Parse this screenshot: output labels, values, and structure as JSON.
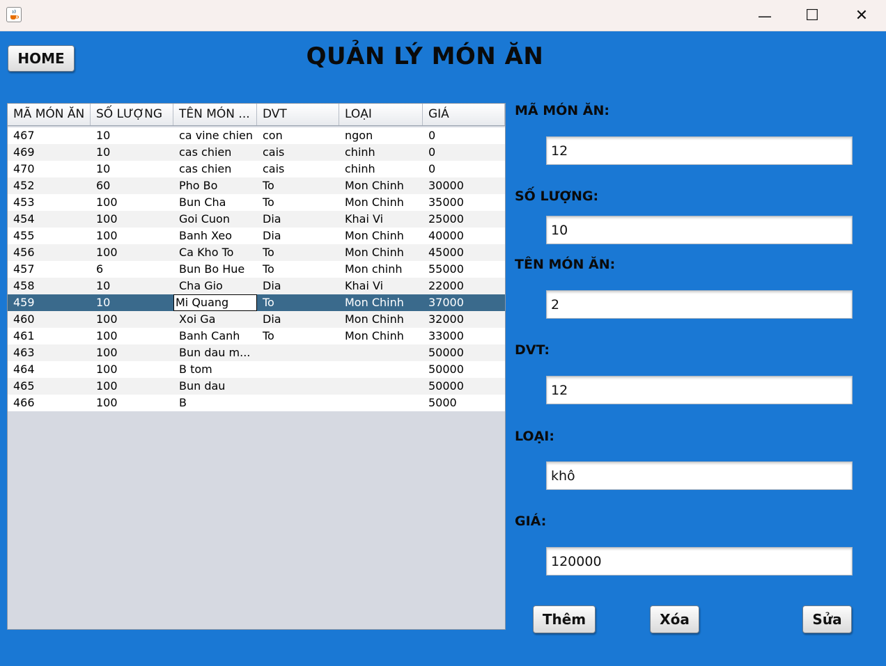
{
  "window": {
    "app_icon": "java-cup-icon",
    "minimize_glyph": "—",
    "maximize_glyph": "☐",
    "close_glyph": "✕"
  },
  "header": {
    "home_label": "HOME",
    "title": "QUẢN LÝ MÓN ĂN"
  },
  "table": {
    "columns": [
      "MÃ MÓN ĂN",
      "SỐ LƯỢNG",
      "TÊN MÓN ...",
      "DVT",
      "LOẠI",
      "GIÁ"
    ],
    "rows": [
      [
        "467",
        "10",
        "ca vine chien",
        "con",
        "ngon",
        "0"
      ],
      [
        "469",
        "10",
        "cas chien",
        "cais",
        "chinh",
        "0"
      ],
      [
        "470",
        "10",
        "cas chien",
        "cais",
        "chinh",
        "0"
      ],
      [
        "452",
        "60",
        "Pho Bo",
        "To",
        "Mon Chinh",
        "30000"
      ],
      [
        "453",
        "100",
        "Bun Cha",
        "To",
        "Mon Chinh",
        "35000"
      ],
      [
        "454",
        "100",
        "Goi Cuon",
        "Dia",
        "Khai Vi",
        "25000"
      ],
      [
        "455",
        "100",
        "Banh Xeo",
        "Dia",
        "Mon Chinh",
        "40000"
      ],
      [
        "456",
        "100",
        "Ca Kho To",
        "To",
        "Mon Chinh",
        "45000"
      ],
      [
        "457",
        "6",
        "Bun Bo Hue",
        "To",
        "Mon chinh",
        "55000"
      ],
      [
        "458",
        "10",
        "Cha Gio",
        "Dia",
        "Khai Vi",
        "22000"
      ],
      [
        "459",
        "10",
        "Mi Quang",
        "To",
        "Mon Chinh",
        "37000"
      ],
      [
        "460",
        "100",
        "Xoi Ga",
        "Dia",
        "Mon Chinh",
        "32000"
      ],
      [
        "461",
        "100",
        "Banh Canh",
        "To",
        "Mon Chinh",
        "33000"
      ],
      [
        "463",
        "100",
        "Bun dau m...",
        "",
        "",
        "50000"
      ],
      [
        "464",
        "100",
        "B tom",
        "",
        "",
        "50000"
      ],
      [
        "465",
        "100",
        "Bun dau",
        "",
        "",
        "50000"
      ],
      [
        "466",
        "100",
        "B",
        "",
        "",
        "5000"
      ]
    ],
    "selected_row": 10,
    "selection_color": "#3a6a8c"
  },
  "form": {
    "ma_label": "MÃ MÓN ĂN:",
    "ma_value": "12",
    "soluong_label": "SỐ LƯỢNG:",
    "soluong_value": "10",
    "ten_label": "TÊN MÓN ĂN:",
    "ten_value": "2",
    "dvt_label": "DVT:",
    "dvt_value": "12",
    "loai_label": "LOẠI:",
    "loai_value": "khô",
    "gia_label": "GIÁ:",
    "gia_value": "120000"
  },
  "actions": {
    "add_label": "Thêm",
    "delete_label": "Xóa",
    "edit_label": "Sửa"
  },
  "colors": {
    "background": "#1a78d4",
    "titlebar": "#f7f0ee"
  }
}
